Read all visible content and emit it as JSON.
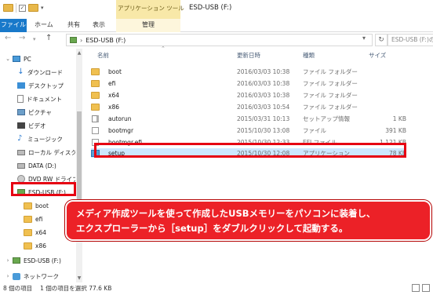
{
  "title_bar": {
    "context_tab": "アプリケーション ツール",
    "window_title": "ESD-USB (F:)"
  },
  "ribbon": {
    "tabs": [
      "ファイル",
      "ホーム",
      "共有",
      "表示",
      "管理"
    ]
  },
  "address": {
    "path_item": "ESD-USB (F:)",
    "search_placeholder": "ESD-USB (F:)の"
  },
  "nav_pane": {
    "items": [
      {
        "label": "PC",
        "icon": "pc-icon"
      },
      {
        "label": "ダウンロード",
        "icon": "download-icon"
      },
      {
        "label": "デスクトップ",
        "icon": "desktop-icon"
      },
      {
        "label": "ドキュメント",
        "icon": "document-icon"
      },
      {
        "label": "ピクチャ",
        "icon": "picture-icon"
      },
      {
        "label": "ビデオ",
        "icon": "video-icon"
      },
      {
        "label": "ミュージック",
        "icon": "music-icon"
      },
      {
        "label": "ローカル ディスク (C",
        "icon": "disk-icon"
      },
      {
        "label": "DATA (D:)",
        "icon": "disk-icon"
      },
      {
        "label": "DVD RW ドライブ (",
        "icon": "dvd-icon"
      },
      {
        "label": "ESD-USB (F:)",
        "icon": "usb-drive-icon"
      },
      {
        "label": "boot",
        "icon": "folder-icon"
      },
      {
        "label": "efi",
        "icon": "folder-icon"
      },
      {
        "label": "x64",
        "icon": "folder-icon"
      },
      {
        "label": "x86",
        "icon": "folder-icon"
      },
      {
        "label": "ESD-USB (F:)",
        "icon": "usb-drive-icon"
      },
      {
        "label": "ネットワーク",
        "icon": "network-icon"
      }
    ]
  },
  "columns": {
    "name": "名前",
    "date": "更新日時",
    "type": "種類",
    "size": "サイズ"
  },
  "files": [
    {
      "name": "boot",
      "date": "2016/03/03 10:38",
      "type": "ファイル フォルダー",
      "size": "",
      "icon": "folder-icon"
    },
    {
      "name": "efi",
      "date": "2016/03/03 10:38",
      "type": "ファイル フォルダー",
      "size": "",
      "icon": "folder-icon"
    },
    {
      "name": "x64",
      "date": "2016/03/03 10:38",
      "type": "ファイル フォルダー",
      "size": "",
      "icon": "folder-icon"
    },
    {
      "name": "x86",
      "date": "2016/03/03 10:54",
      "type": "ファイル フォルダー",
      "size": "",
      "icon": "folder-icon"
    },
    {
      "name": "autorun",
      "date": "2015/03/31 10:13",
      "type": "セットアップ情報",
      "size": "1 KB",
      "icon": "setup-info-icon"
    },
    {
      "name": "bootmgr",
      "date": "2015/10/30 13:08",
      "type": "ファイル",
      "size": "391 KB",
      "icon": "file-icon"
    },
    {
      "name": "bootmgr.efi",
      "date": "2015/10/30 12:33",
      "type": "EFI ファイル",
      "size": "1,121 KB",
      "icon": "file-icon"
    },
    {
      "name": "setup",
      "date": "2015/10/30 12:08",
      "type": "アプリケーション",
      "size": "78 KB",
      "icon": "setup-app-icon"
    }
  ],
  "callout": {
    "line1": "メディア作成ツールを使って作成したUSBメモリーをパソコンに装着し、",
    "line2": "エクスプローラーから［setup］をダブルクリックして起動する。"
  },
  "status_bar": {
    "item_count": "8 個の項目",
    "selection": "1 個の項目を選択  77.6 KB"
  },
  "colors": {
    "accent": "#1979ca",
    "highlight": "#e60012",
    "callout_bg": "#ec2127",
    "selection": "#cce8ff"
  }
}
